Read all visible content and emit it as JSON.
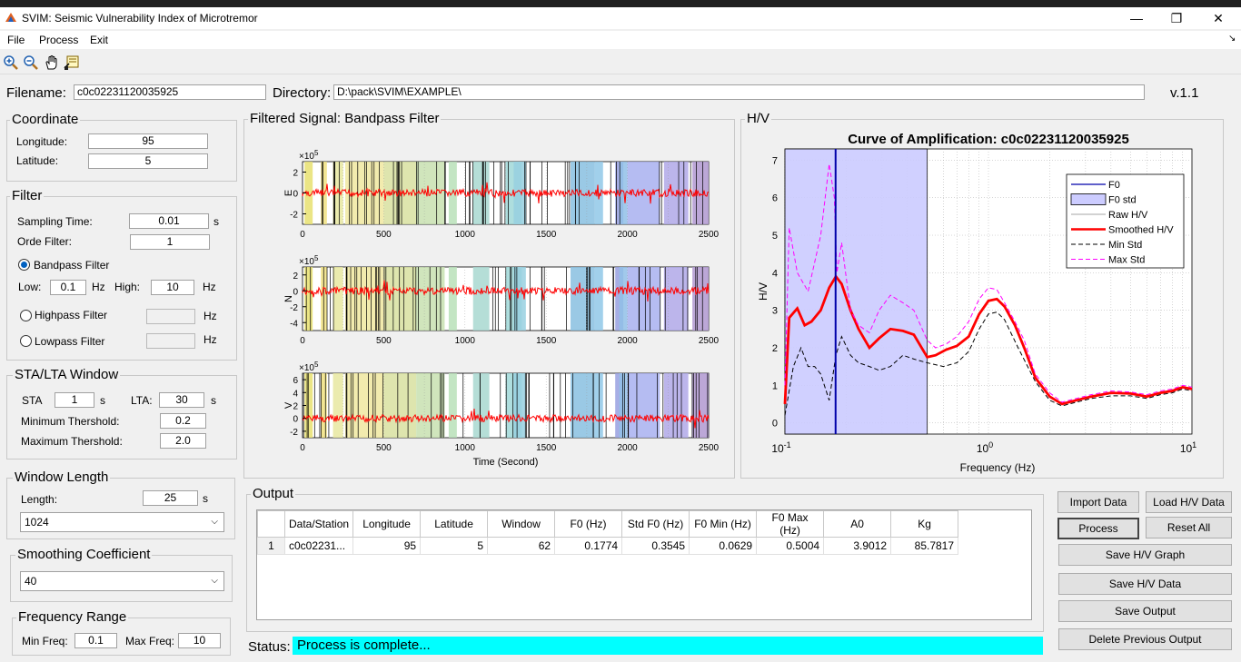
{
  "window": {
    "title": "SVIM: Seismic Vulnerability Index of Microtremor",
    "min_icon": "minimize-icon",
    "max_icon": "restore-icon",
    "close_icon": "close-icon"
  },
  "menu": [
    "File",
    "Process",
    "Exit"
  ],
  "toolbar_icons": [
    "zoom-in-icon",
    "zoom-out-icon",
    "pan-hand-icon",
    "data-cursor-icon"
  ],
  "header": {
    "filename_label": "Filename:",
    "filename": "c0c02231120035925",
    "directory_label": "Directory:",
    "directory": "D:\\pack\\SVIM\\EXAMPLE\\",
    "version": "v.1.1"
  },
  "coordinate": {
    "title": "Coordinate",
    "lon_label": "Longitude:",
    "lon": "95",
    "lat_label": "Latitude:",
    "lat": "5"
  },
  "filter": {
    "title": "Filter",
    "sampling_label": "Sampling Time:",
    "sampling": "0.01",
    "sampling_unit": "s",
    "orde_label": "Orde Filter:",
    "orde": "1",
    "bandpass_label": "Bandpass Filter",
    "low_label": "Low:",
    "low": "0.1",
    "low_unit": "Hz",
    "high_label": "High:",
    "high": "10",
    "high_unit": "Hz",
    "highpass_label": "Highpass Filter",
    "highpass_unit": "Hz",
    "lowpass_label": "Lowpass Filter",
    "lowpass_unit": "Hz"
  },
  "stalta": {
    "title": "STA/LTA Window",
    "sta_label": "STA",
    "sta": "1",
    "sta_unit": "s",
    "lta_label": "LTA:",
    "lta": "30",
    "lta_unit": "s",
    "min_label": "Minimum Thershold:",
    "min": "0.2",
    "max_label": "Maximum Thershold:",
    "max": "2.0"
  },
  "window_length": {
    "title": "Window Length",
    "length_label": "Length:",
    "length": "25",
    "unit": "s",
    "select": "1024"
  },
  "smoothing": {
    "title": "Smoothing Coefficient",
    "select": "40"
  },
  "freq_range": {
    "title": "Frequency Range",
    "min_label": "Min Freq:",
    "min": "0.1",
    "max_label": "Max Freq:",
    "max": "10"
  },
  "signal_panel": {
    "title": "Filtered Signal: Bandpass Filter",
    "exponent": "×10",
    "exp_power": "5",
    "xlabel": "Time (Second)",
    "xticks": [
      "0",
      "500",
      "1000",
      "1500",
      "2000",
      "2500"
    ],
    "channels": [
      {
        "name": "E",
        "yticks": [
          "2",
          "0",
          "-2"
        ]
      },
      {
        "name": "N",
        "yticks": [
          "2",
          "0",
          "-2",
          "-4"
        ]
      },
      {
        "name": "V",
        "yticks": [
          "6",
          "4",
          "2",
          "0",
          "-2"
        ]
      }
    ]
  },
  "hv_panel": {
    "title": "H/V",
    "plot_title": "Curve of Amplification: c0c02231120035925",
    "xlabel": "Frequency (Hz)",
    "ylabel": "H/V",
    "yticks": [
      "0",
      "1",
      "2",
      "3",
      "4",
      "5",
      "6",
      "7"
    ],
    "xtick_base": "10",
    "xtick_exps": [
      "-1",
      "0",
      "1"
    ],
    "legend": [
      "F0",
      "F0 std",
      "Raw H/V",
      "Smoothed H/V",
      "Min Std",
      "Max Std"
    ]
  },
  "chart_data": {
    "type": "line",
    "title": "Curve of Amplification: c0c02231120035925",
    "xlabel": "Frequency (Hz)",
    "ylabel": "H/V",
    "xscale": "log",
    "xlim": [
      0.1,
      10
    ],
    "ylim": [
      -0.3,
      7.3
    ],
    "f0": 0.1774,
    "f0_std_range": [
      0.1,
      0.5004
    ],
    "series": [
      {
        "name": "Smoothed H/V",
        "color": "#ff0000",
        "x": [
          0.1,
          0.105,
          0.115,
          0.125,
          0.135,
          0.15,
          0.165,
          0.178,
          0.19,
          0.21,
          0.23,
          0.26,
          0.29,
          0.33,
          0.38,
          0.43,
          0.5,
          0.55,
          0.62,
          0.7,
          0.8,
          0.9,
          1.0,
          1.1,
          1.2,
          1.35,
          1.5,
          1.7,
          2.0,
          2.3,
          2.7,
          3.2,
          4.0,
          5.0,
          6.0,
          7.0,
          8.0,
          9.0,
          10.0
        ],
        "y": [
          0.5,
          2.8,
          3.05,
          2.6,
          2.7,
          3.0,
          3.6,
          3.9,
          3.7,
          3.0,
          2.5,
          2.0,
          2.25,
          2.5,
          2.45,
          2.35,
          1.75,
          1.8,
          1.95,
          2.05,
          2.3,
          2.9,
          3.25,
          3.3,
          3.1,
          2.6,
          2.0,
          1.2,
          0.7,
          0.5,
          0.6,
          0.7,
          0.8,
          0.78,
          0.7,
          0.8,
          0.85,
          0.95,
          0.9
        ]
      },
      {
        "name": "Min Std",
        "color": "#000000",
        "x": [
          0.1,
          0.11,
          0.12,
          0.13,
          0.14,
          0.15,
          0.165,
          0.178,
          0.19,
          0.21,
          0.23,
          0.26,
          0.29,
          0.33,
          0.38,
          0.43,
          0.5,
          0.6,
          0.7,
          0.8,
          0.9,
          1.0,
          1.1,
          1.2,
          1.4,
          1.7,
          2.0,
          2.3,
          2.7,
          3.2,
          4.0,
          5.0,
          6.0,
          7.0,
          8.0,
          9.0,
          10.0
        ],
        "y": [
          0.2,
          1.5,
          2.0,
          1.5,
          1.5,
          1.3,
          0.6,
          1.8,
          2.3,
          1.8,
          1.6,
          1.5,
          1.4,
          1.5,
          1.8,
          1.7,
          1.6,
          1.5,
          1.6,
          1.9,
          2.5,
          2.9,
          2.95,
          2.75,
          2.0,
          1.1,
          0.6,
          0.45,
          0.55,
          0.65,
          0.72,
          0.72,
          0.65,
          0.75,
          0.8,
          0.9,
          0.85
        ]
      },
      {
        "name": "Max Std",
        "color": "#ff00ff",
        "x": [
          0.1,
          0.105,
          0.115,
          0.13,
          0.15,
          0.165,
          0.175,
          0.18,
          0.19,
          0.21,
          0.23,
          0.26,
          0.29,
          0.33,
          0.38,
          0.43,
          0.5,
          0.55,
          0.62,
          0.7,
          0.8,
          0.9,
          1.0,
          1.1,
          1.2,
          1.35,
          1.5,
          1.7,
          2.0,
          2.3,
          2.7,
          3.2,
          4.0,
          5.0,
          6.0,
          7.0,
          8.0,
          9.0,
          10.0
        ],
        "y": [
          1.0,
          5.2,
          4.0,
          3.5,
          5.0,
          6.9,
          6.0,
          4.0,
          4.8,
          3.0,
          2.6,
          2.4,
          3.0,
          3.4,
          3.2,
          3.0,
          2.2,
          2.0,
          2.1,
          2.3,
          2.7,
          3.3,
          3.6,
          3.55,
          3.2,
          2.7,
          2.2,
          1.3,
          0.8,
          0.55,
          0.65,
          0.75,
          0.85,
          0.82,
          0.75,
          0.85,
          0.9,
          1.0,
          0.95
        ]
      }
    ]
  },
  "output": {
    "title": "Output",
    "columns": [
      "Data/Station",
      "Longitude",
      "Latitude",
      "Window",
      "F0 (Hz)",
      "Std F0 (Hz)",
      "F0 Min (Hz)",
      "F0 Max (Hz)",
      "A0",
      "Kg"
    ],
    "rows": [
      [
        "1",
        "c0c02231...",
        "95",
        "5",
        "62",
        "0.1774",
        "0.3545",
        "0.0629",
        "0.5004",
        "3.9012",
        "85.7817"
      ]
    ]
  },
  "buttons": {
    "import": "Import Data",
    "load": "Load H/V Data",
    "process": "Process",
    "reset": "Reset All",
    "save_graph": "Save H/V Graph",
    "save_data": "Save H/V Data",
    "save_output": "Save Output",
    "delete": "Delete Previous Output"
  },
  "status": {
    "label": "Status:",
    "text": "Process is complete..."
  }
}
